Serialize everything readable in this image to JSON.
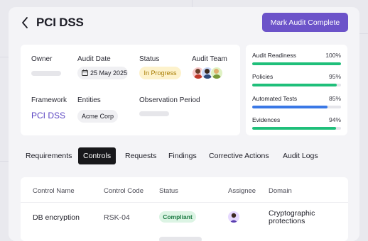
{
  "header": {
    "title": "PCI DSS",
    "primary_action": "Mark Audit Complete"
  },
  "info": {
    "owner_label": "Owner",
    "audit_date_label": "Audit Date",
    "audit_date_value": "25 May 2025",
    "status_label": "Status",
    "status_value": "In Progress",
    "audit_team_label": "Audit Team",
    "framework_label": "Framework",
    "framework_value": "PCI DSS",
    "entities_label": "Entities",
    "entities_value": "Acme Corp",
    "observation_label": "Observation Period"
  },
  "progress": [
    {
      "label": "Audit Readiness",
      "percent_text": "100%",
      "value": 100,
      "color": "#1fbf7a"
    },
    {
      "label": "Policies",
      "percent_text": "95%",
      "value": 95,
      "color": "#1fbf7a"
    },
    {
      "label": "Automated Tests",
      "percent_text": "85%",
      "value": 85,
      "color": "#3a78e6"
    },
    {
      "label": "Evidences",
      "percent_text": "94%",
      "value": 94,
      "color": "#1fbf7a"
    }
  ],
  "tabs": [
    {
      "label": "Requirements",
      "active": false
    },
    {
      "label": "Controls",
      "active": true
    },
    {
      "label": "Requests",
      "active": false
    },
    {
      "label": "Findings",
      "active": false
    },
    {
      "label": "Corrective Actions",
      "active": false
    },
    {
      "label": "Audit Logs",
      "active": false
    }
  ],
  "table": {
    "columns": [
      "Control Name",
      "Control Code",
      "Status",
      "Assignee",
      "Domain"
    ],
    "rows": [
      {
        "name": "DB encryption",
        "code": "RSK-04",
        "status": "Compliant",
        "domain": "Cryptographic protections"
      }
    ]
  },
  "colors": {
    "accent": "#6c53c9",
    "status_in_progress_bg": "#fdf2cc",
    "compliant_bg": "#dcf4e4"
  }
}
